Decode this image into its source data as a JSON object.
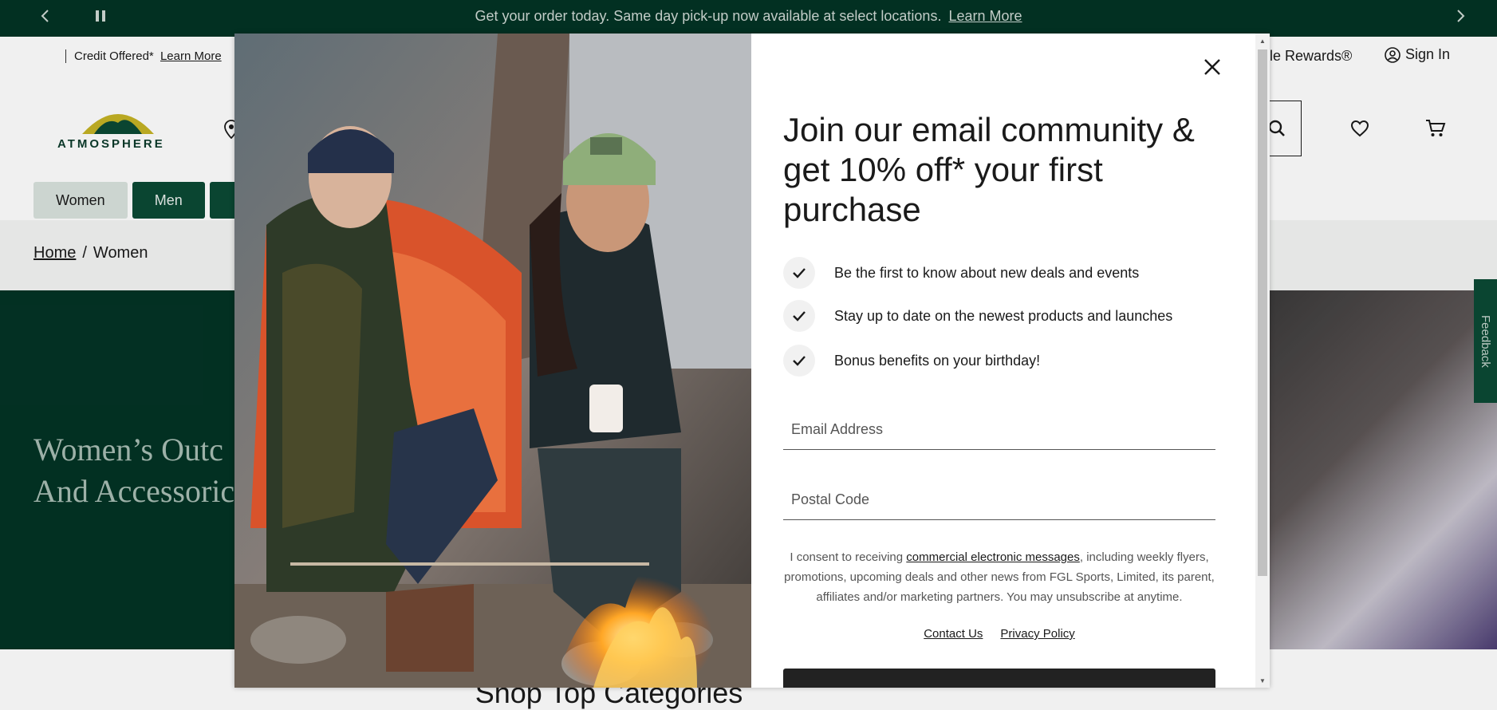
{
  "announcement": {
    "text": "Get your order today. Same day pick-up now available at select locations.",
    "link": "Learn More"
  },
  "utility": {
    "credit_text": "Credit Offered*",
    "credit_link": "Learn More",
    "rewards_text": "ngle Rewards®",
    "signin": "Sign In"
  },
  "logo": {
    "text": "ATMOSPHERE"
  },
  "nav": {
    "tabs": [
      "Women",
      "Men"
    ]
  },
  "breadcrumb": {
    "home": "Home",
    "separator": "/",
    "current": "Women"
  },
  "hero": {
    "title_line1": "Women’s Outc",
    "title_line2": "And Accessoric"
  },
  "feedback": "Feedback",
  "section_title": "Shop Top Categories",
  "modal": {
    "heading": "Join our email community & get 10% off* your first purchase",
    "benefits": [
      "Be the first to know about new deals and events",
      "Stay up to date on the newest products and launches",
      "Bonus benefits on your birthday!"
    ],
    "email_placeholder": "Email Address",
    "postal_placeholder": "Postal Code",
    "consent_prefix": "I consent to receiving",
    "consent_link": "commercial electronic messages",
    "consent_suffix": ", including weekly flyers, promotions, upcoming deals and other news from FGL Sports, Limited, its parent, affiliates and/or marketing partners. You may unsubscribe at anytime.",
    "contact_link": "Contact Us",
    "privacy_link": "Privacy Policy"
  },
  "colors": {
    "brand_green": "#033325",
    "tab_green": "#0b4a35",
    "submit_dark": "#222222"
  },
  "icons": [
    "chevron-left-icon",
    "pause-icon",
    "chevron-right-icon",
    "user-icon",
    "search-icon",
    "heart-icon",
    "cart-icon",
    "close-icon",
    "check-icon",
    "location-pin-icon"
  ]
}
